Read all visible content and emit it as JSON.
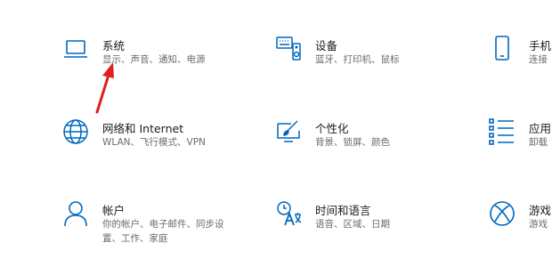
{
  "accent_color": "#0067c0",
  "annotation_color": "#e02020",
  "tiles": [
    {
      "icon": "laptop-icon",
      "title": "系统",
      "desc_lines": [
        "显示、声音、通知、电源"
      ]
    },
    {
      "icon": "keyboard-speaker-icon",
      "title": "设备",
      "desc_lines": [
        "蓝牙、打印机、鼠标"
      ]
    },
    {
      "icon": "phone-icon",
      "title": "手机",
      "desc_lines": [
        "连接"
      ]
    },
    {
      "icon": "globe-icon",
      "title": "网络和 Internet",
      "desc_lines": [
        "WLAN、飞行模式、VPN"
      ]
    },
    {
      "icon": "personalization-icon",
      "title": "个性化",
      "desc_lines": [
        "背景、锁屏、颜色"
      ]
    },
    {
      "icon": "apps-list-icon",
      "title": "应用",
      "desc_lines": [
        "卸载"
      ]
    },
    {
      "icon": "person-icon",
      "title": "帐户",
      "desc_lines": [
        "你的帐户、电子邮件、同步设",
        "置、工作、家庭"
      ]
    },
    {
      "icon": "time-language-icon",
      "title": "时间和语言",
      "desc_lines": [
        "语音、区域、日期"
      ]
    },
    {
      "icon": "xbox-icon",
      "title": "游戏",
      "desc_lines": [
        "游戏"
      ]
    }
  ]
}
